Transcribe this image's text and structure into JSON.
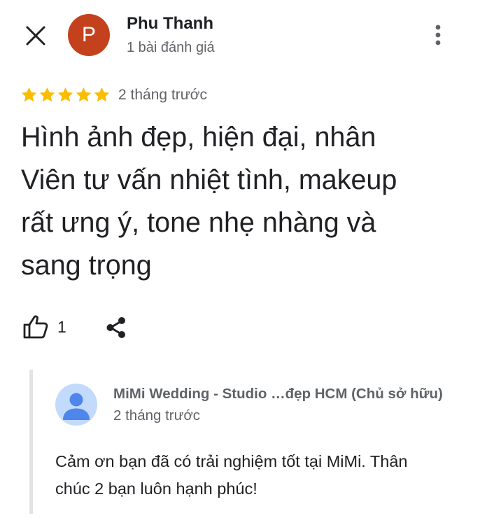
{
  "header": {
    "reviewer_name": "Phu Thanh",
    "avatar_letter": "P",
    "review_count": "1 bài đánh giá",
    "avatar_color": "#c4411d",
    "close_icon": "close-icon",
    "more_icon": "more-vert-icon"
  },
  "review": {
    "rating": 5,
    "rating_max": 5,
    "star_color": "#fbbc04",
    "time": "2 tháng trước",
    "text_lines": [
      "Hình ảnh đẹp, hiện đại, nhân",
      "Viên tư vấn nhiệt tình, makeup",
      "rất ưng ý, tone nhẹ nhàng và",
      "sang trọng"
    ]
  },
  "actions": {
    "like_icon": "thumb-up-icon",
    "like_count": "1",
    "share_icon": "share-icon"
  },
  "owner_reply": {
    "name": "MiMi Wedding - Studio …đẹp HCM (Chủ sở hữu)",
    "time": "2 tháng trước",
    "avatar_icon": "person-icon",
    "avatar_bg": "#c2dafc",
    "avatar_fg": "#4f86ec",
    "text_lines": [
      "Cảm ơn bạn đã có trải nghiệm tốt tại MiMi. Thân",
      "chúc 2 bạn luôn hạnh phúc!"
    ]
  }
}
